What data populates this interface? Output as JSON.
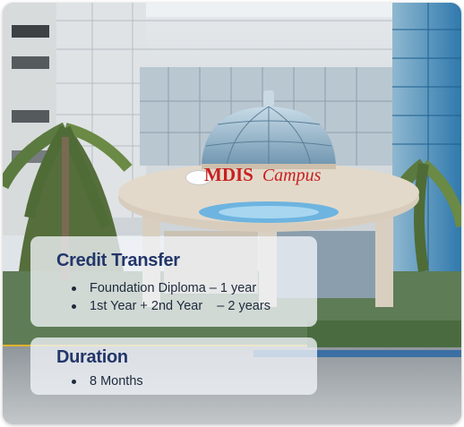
{
  "sign": {
    "name": "MDIS",
    "word": "Campus"
  },
  "credit_transfer": {
    "heading": "Credit Transfer",
    "items": [
      "Foundation Diploma – 1 year",
      "1st Year + 2nd Year    – 2 years"
    ]
  },
  "duration": {
    "heading": "Duration",
    "items": [
      "8 Months"
    ]
  },
  "colors": {
    "heading": "#23366a",
    "sign_red": "#c8201f",
    "panel": "#f1f4f8"
  }
}
